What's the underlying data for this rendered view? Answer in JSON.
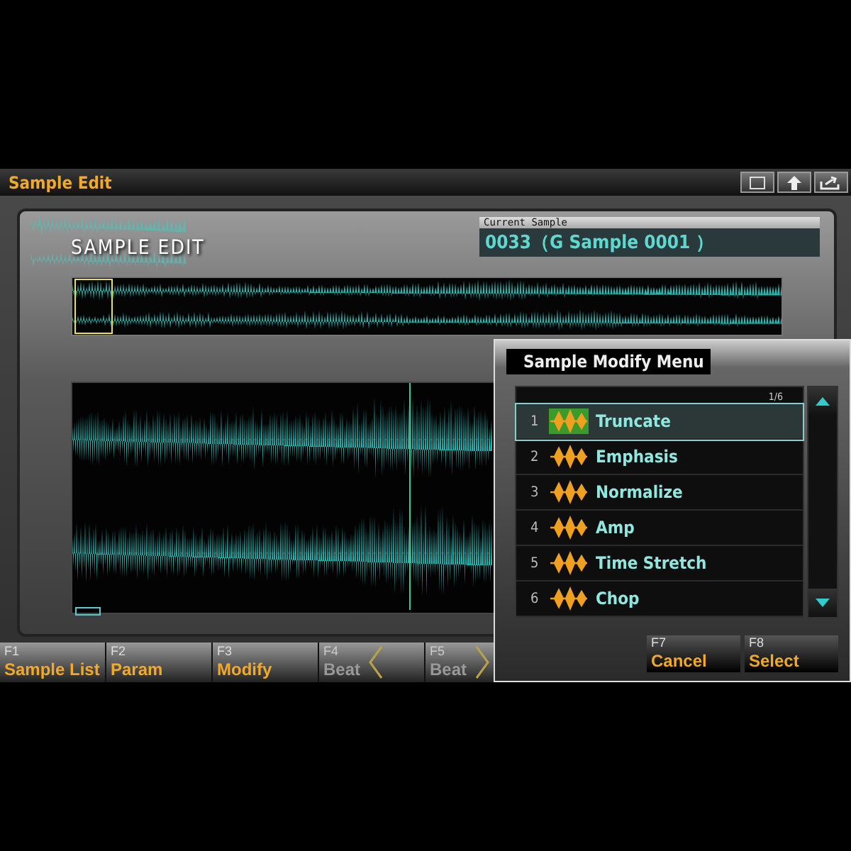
{
  "window": {
    "title": "Sample Edit"
  },
  "header": {
    "logo": "SAMPLE EDIT",
    "current_sample": {
      "label": "Current Sample",
      "value": "0033（G Sample 0001 ）"
    }
  },
  "function_keys": [
    {
      "key": "F1",
      "label": "Sample List",
      "disabled": false,
      "kind": "plain"
    },
    {
      "key": "F2",
      "label": "Param",
      "disabled": false,
      "kind": "plain"
    },
    {
      "key": "F3",
      "label": "Modify",
      "disabled": false,
      "kind": "plain"
    },
    {
      "key": "F4",
      "label": "Beat",
      "disabled": true,
      "kind": "previous"
    },
    {
      "key": "F5",
      "label": "Beat",
      "disabled": true,
      "kind": "next"
    }
  ],
  "dialog": {
    "title": "Sample Modify Menu",
    "page": "1/6",
    "items": [
      {
        "number": "1",
        "label": "Truncate",
        "selected": true
      },
      {
        "number": "2",
        "label": "Emphasis",
        "selected": false
      },
      {
        "number": "3",
        "label": "Normalize",
        "selected": false
      },
      {
        "number": "4",
        "label": "Amp",
        "selected": false
      },
      {
        "number": "5",
        "label": "Time Stretch",
        "selected": false
      },
      {
        "number": "6",
        "label": "Chop",
        "selected": false
      }
    ],
    "buttons": [
      {
        "key": "F7",
        "label": "Cancel"
      },
      {
        "key": "F8",
        "label": "Select"
      }
    ]
  }
}
